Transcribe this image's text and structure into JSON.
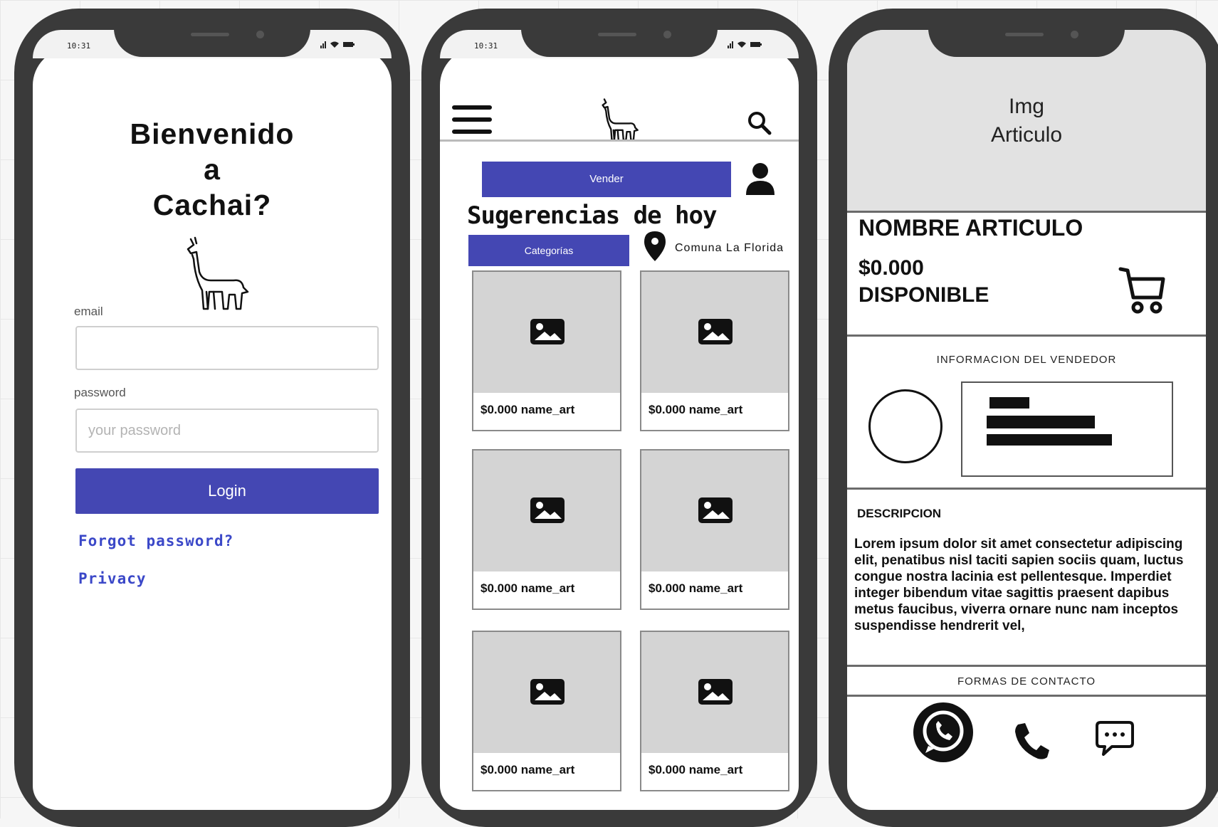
{
  "screens": {
    "login": {
      "status_time": "10:31",
      "welcome_lines": [
        "Bienvenido",
        "a",
        "Cachai?"
      ],
      "email_label": "email",
      "email_value": "",
      "password_label": "password",
      "password_placeholder": "your password",
      "login_label": "Login",
      "forgot_label": "Forgot password?",
      "privacy_label": "Privacy"
    },
    "home": {
      "status_time": "10:31",
      "sell_label": "Vender",
      "suggestions_title": "Sugerencias de hoy",
      "categories_label": "Categorías",
      "location_label": "Comuna La Florida",
      "products": [
        {
          "caption": "$0.000 name_art"
        },
        {
          "caption": "$0.000 name_art"
        },
        {
          "caption": "$0.000 name_art"
        },
        {
          "caption": "$0.000 name_art"
        },
        {
          "caption": "$0.000 name_art"
        },
        {
          "caption": "$0.000 name_art"
        }
      ]
    },
    "detail": {
      "image_placeholder_line1": "Img",
      "image_placeholder_line2": "Articulo",
      "item_name": "NOMBRE ARTICULO",
      "item_price": "$0.000",
      "item_status": "DISPONIBLE",
      "seller_info_title": "INFORMACION DEL VENDEDOR",
      "description_title": "DESCRIPCION",
      "description_text": "Lorem ipsum dolor sit amet consectetur adipiscing elit, penatibus nisl taciti sapien sociis quam, luctus congue nostra lacinia est pellentesque. Imperdiet integer bibendum vitae sagittis praesent dapibus metus faucibus, viverra ornare nunc nam inceptos suspendisse hendrerit vel,",
      "contact_title": "FORMAS DE CONTACTO"
    }
  },
  "colors": {
    "accent": "#4447b3",
    "link": "#3b48c8",
    "frame": "#3a3a3a",
    "placeholder_gray": "#d4d4d4"
  },
  "icons": [
    "menu-icon",
    "llama-logo-icon",
    "search-icon",
    "user-icon",
    "location-pin-icon",
    "image-placeholder-icon",
    "cart-icon",
    "whatsapp-icon",
    "phone-icon",
    "chat-icon"
  ]
}
